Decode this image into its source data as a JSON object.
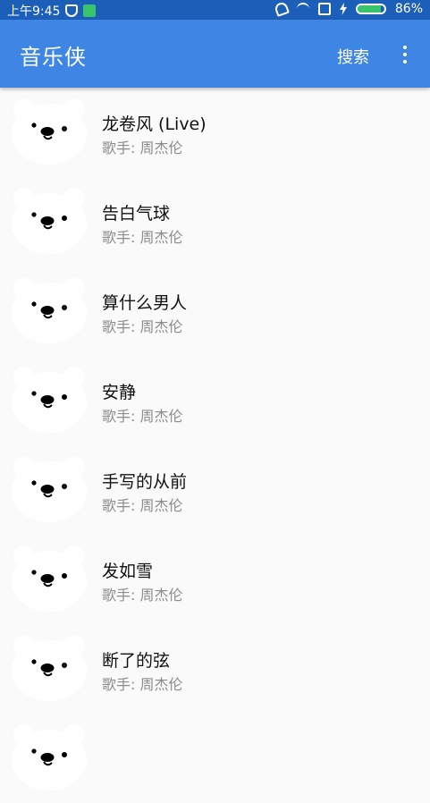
{
  "status_bar": {
    "time": "上午9:45",
    "battery_level": "86%",
    "battery_fraction": 0.86,
    "icons": [
      "shield-icon",
      "sim-icon",
      "mute-icon",
      "wifi-icon",
      "no-sim-icon",
      "charging-icon",
      "battery-icon"
    ]
  },
  "app_bar": {
    "title": "音乐侠",
    "search_label": "搜索",
    "overflow_icon": "more-vert-icon"
  },
  "songs": [
    {
      "title": "龙卷风 (Live)",
      "artist": "歌手: 周杰伦"
    },
    {
      "title": "告白气球",
      "artist": "歌手: 周杰伦"
    },
    {
      "title": "算什么男人",
      "artist": "歌手: 周杰伦"
    },
    {
      "title": "安静",
      "artist": "歌手: 周杰伦"
    },
    {
      "title": "手写的从前",
      "artist": "歌手: 周杰伦"
    },
    {
      "title": "发如雪",
      "artist": "歌手: 周杰伦"
    },
    {
      "title": "断了的弦",
      "artist": "歌手: 周杰伦"
    },
    {
      "title": "",
      "artist": ""
    }
  ],
  "colors": {
    "status_bar": "#1c5fb8",
    "app_bar": "#3f86e4",
    "background": "#fafafa",
    "artist_text": "#8c8c8c"
  }
}
